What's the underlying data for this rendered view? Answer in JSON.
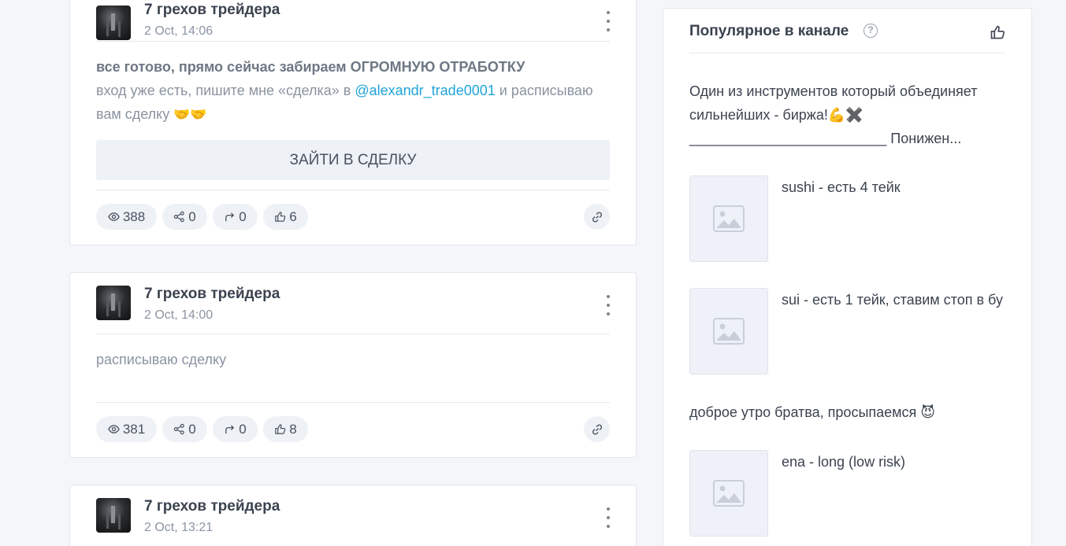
{
  "posts": [
    {
      "channel": "7 грехов трейдера",
      "date": "2 Oct, 14:06",
      "text_bold": "все готово, прямо сейчас забираем ОГРОМНУЮ ОТРАБОТКУ",
      "text_pre": "вход уже есть, пишите мне «сделка» в ",
      "mention": "@alexandr_trade0001",
      "text_post": " и расписываю вам сделку ",
      "emoji": "🤝🤝",
      "cta": "ЗАЙТИ В СДЕЛКУ",
      "views": "388",
      "shares": "0",
      "reposts": "0",
      "likes": "6"
    },
    {
      "channel": "7 грехов трейдера",
      "date": "2 Oct, 14:00",
      "text": "расписываю сделку",
      "views": "381",
      "shares": "0",
      "reposts": "0",
      "likes": "8"
    },
    {
      "channel": "7 грехов трейдера",
      "date": "2 Oct, 13:21"
    }
  ],
  "sidebar": {
    "title": "Популярное в канале",
    "help": "?",
    "items": [
      {
        "text_line1": "Один из инструментов который объединяет",
        "text_line2": "сильнейших - биржа!💪✖️",
        "text_line3": "_________________________ Понижен..."
      },
      {
        "caption": "sushi - есть 4 тейк",
        "image": "placeholder-image-icon"
      },
      {
        "caption": "sui - есть 1 тейк, ставим стоп в бу",
        "image": "placeholder-image-icon"
      },
      {
        "text": "доброе утро братва, просыпаемся 😈"
      },
      {
        "caption": "ena - long (low risk)",
        "image": "placeholder-image-icon"
      }
    ]
  },
  "colors": {
    "accent_link": "#1fa4d8",
    "chip_bg": "#eef1f6",
    "page_bg": "#f5f6f9"
  }
}
